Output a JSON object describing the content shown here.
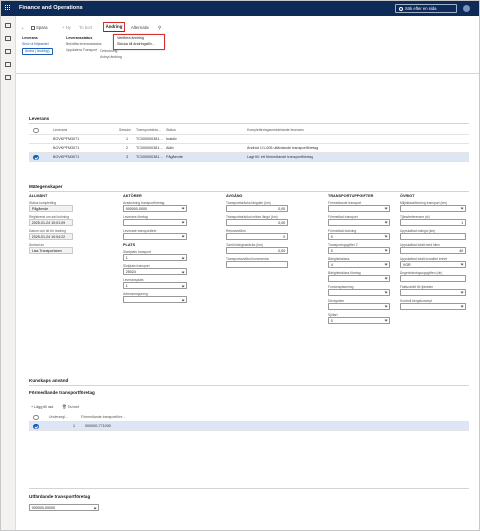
{
  "app": {
    "title": "Finance and Operations",
    "search_label": "Sök efter en sida"
  },
  "toolbar": {
    "back": "←",
    "save": "Spara",
    "new": "+ Ny",
    "delete": "To bort",
    "tab_active": "Ändring",
    "tab_other": "Alternativ",
    "search_icon": "⚲"
  },
  "dropdown": {
    "item1": "Verifiera ändring",
    "item2": "Skicka till ändringsför…"
  },
  "groups": {
    "g1_title": "Leverans",
    "g1_line1": "Skriv ut följesedel",
    "g1_button": "Ändra ( ändring)",
    "g2_title": "Leveransstatus",
    "g2_line1": "Bekräfta leveransstatus",
    "g2_line2": "Uppdatera Transport",
    "g3_line1": "Ombokning",
    "g3_line2": "Avbryt ändring"
  },
  "deliveries": {
    "title": "Leverans",
    "headers": [
      "",
      "Leverans",
      "Session",
      "Transportdeta…",
      "Status",
      "Kompletteringsmeddelande leverans"
    ],
    "rows": [
      {
        "delivery": "BOVKPFM3071",
        "session": "1",
        "transport": "TC000000381…",
        "status": "Inaktiv",
        "message": ""
      },
      {
        "delivery": "BOVKPFM3071",
        "session": "2",
        "transport": "TC000000381…",
        "status": "Aktiv",
        "message": "Ändrad 1/1-005 utfärdande transportföretag"
      },
      {
        "delivery": "BOVKPFM3071",
        "session": "3",
        "transport": "TC000000381…",
        "status": "Pågående",
        "message": "Lagt till: ett förmedlande transportföretag"
      }
    ]
  },
  "props": {
    "title": "Mätegenskaper",
    "col1": {
      "header": "ALLMÄNT",
      "fields": [
        {
          "label": "Status kompletting",
          "value": "Pågående"
        },
        {
          "label": "Registrerat om sist bokning",
          "value": "2025-01-24 10:01:09"
        },
        {
          "label": "Datum och tid för ändring",
          "value": "2025-01-24 10:04:22"
        },
        {
          "label": "Ändrad av",
          "value": "Lisa Transportanm"
        }
      ]
    },
    "col2": {
      "header": "AKTÖRER",
      "fields": [
        {
          "label": "Avsändning transportföretag",
          "value": "000000-0000"
        },
        {
          "label": "Leverans företag",
          "value": ""
        },
        {
          "label": "Leverade transportörer",
          "value": ""
        }
      ],
      "plats_header": "PLATS",
      "plats_fields": [
        {
          "label": "Startplats transport",
          "value": "1"
        },
        {
          "label": "Slutplats transport",
          "value": "25024"
        },
        {
          "label": "Leveransplats",
          "value": "1"
        },
        {
          "label": "Adressmappning",
          "value": ""
        }
      ]
    },
    "col3": {
      "header": "AVGÅNG",
      "fields": [
        {
          "label": "Transportsträcka längden (km)",
          "value": "0,00"
        },
        {
          "label": "Transportsträcka inrikes längd (km)",
          "value": "0,00"
        },
        {
          "label": "Returavstånd",
          "value": "0"
        },
        {
          "label": "Tomkörningssträcka (km)",
          "value": "0,00"
        },
        {
          "label": "Transportavstånd kommentar",
          "value": ""
        }
      ]
    },
    "col4": {
      "header": "TRANSPORTUPPGIFTER",
      "fields": [
        {
          "label": "Förmedlande transport",
          "value": ""
        },
        {
          "label": "Förmedlad transport",
          "value": ""
        },
        {
          "label": "Förmedlad bokning",
          "value": "0"
        },
        {
          "label": "Transportuppgifter 2",
          "value": "0"
        },
        {
          "label": "Bärighetsklass",
          "value": "4"
        },
        {
          "label": "Bärighetsklass företag",
          "value": ""
        },
        {
          "label": "Fordonsplacering",
          "value": ""
        },
        {
          "label": "Drivsystem",
          "value": ""
        },
        {
          "label": "Sjöfart",
          "value": "0"
        }
      ]
    },
    "col5": {
      "header": "ÖVRIGT",
      "fields": [
        {
          "label": "Miljöklassificering transport (km)",
          "value": ""
        },
        {
          "label": "Tjänstreferenser (st)",
          "value": "1"
        },
        {
          "label": "Uppskattad mängd (km)",
          "value": ""
        },
        {
          "label": "Uppskattad totalt med bilen",
          "value": "40"
        },
        {
          "label": "Uppskattad totalt kvantitet enhet",
          "value": "VGR"
        },
        {
          "label": "Ångerbokningsuppgiften (dn)",
          "value": ""
        },
        {
          "label": "Fakturarätt för tjänsten",
          "value": ""
        },
        {
          "label": "Kontroll bergskoncept",
          "value": ""
        }
      ]
    }
  },
  "sections": {
    "s1": "Kunskaps använd",
    "s2": "Förmedlande transportföretag",
    "s3": "Utfärdande transportföretag"
  },
  "intermediaries": {
    "add_label": "+ Lägg till rad",
    "remove_label": "Ta bort",
    "headers": [
      "",
      "Undersegl…",
      "Förmedlande transportföre…"
    ],
    "rows": [
      {
        "seq": "1",
        "value": "000000-771000"
      }
    ]
  },
  "issuer": {
    "value": "000000-00000"
  }
}
